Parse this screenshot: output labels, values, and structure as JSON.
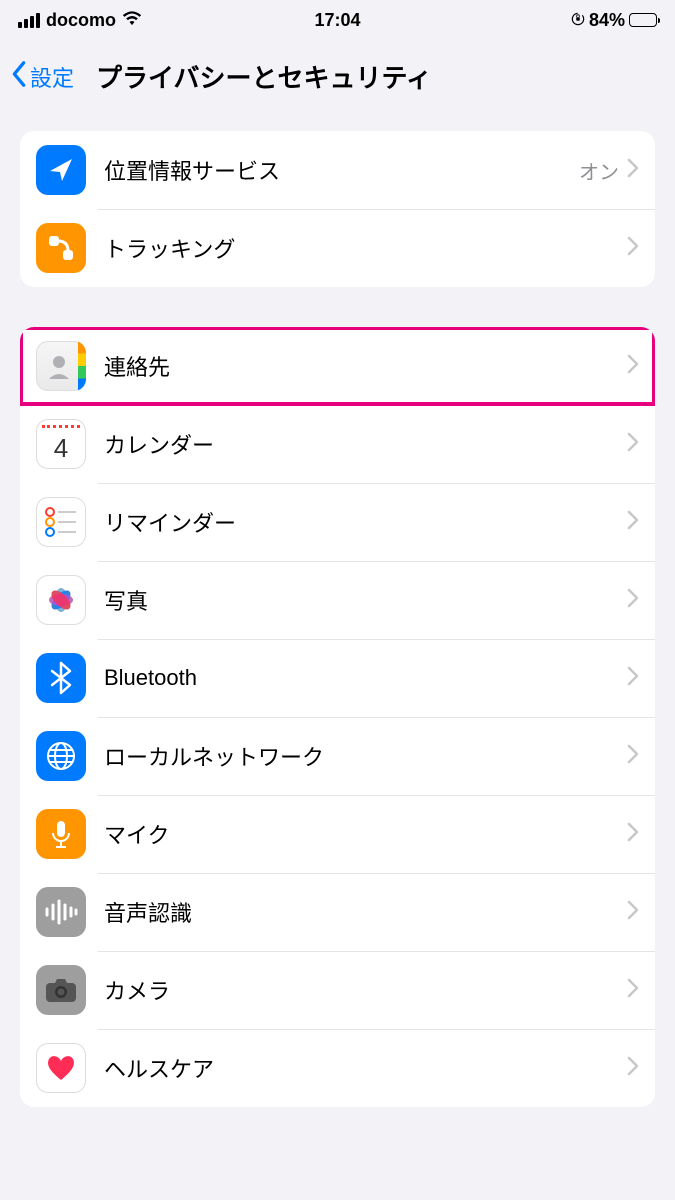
{
  "status": {
    "carrier": "docomo",
    "time": "17:04",
    "battery_pct": "84%"
  },
  "nav": {
    "back_label": "設定",
    "title": "プライバシーとセキュリティ"
  },
  "section1": [
    {
      "label": "位置情報サービス",
      "value": "オン",
      "icon": "location"
    },
    {
      "label": "トラッキング",
      "value": "",
      "icon": "tracking"
    }
  ],
  "section2": [
    {
      "label": "連絡先",
      "icon": "contacts",
      "highlighted": true
    },
    {
      "label": "カレンダー",
      "icon": "calendar"
    },
    {
      "label": "リマインダー",
      "icon": "reminders"
    },
    {
      "label": "写真",
      "icon": "photos"
    },
    {
      "label": "Bluetooth",
      "icon": "bluetooth"
    },
    {
      "label": "ローカルネットワーク",
      "icon": "network"
    },
    {
      "label": "マイク",
      "icon": "mic"
    },
    {
      "label": "音声認識",
      "icon": "speech"
    },
    {
      "label": "カメラ",
      "icon": "camera"
    },
    {
      "label": "ヘルスケア",
      "icon": "health"
    }
  ]
}
